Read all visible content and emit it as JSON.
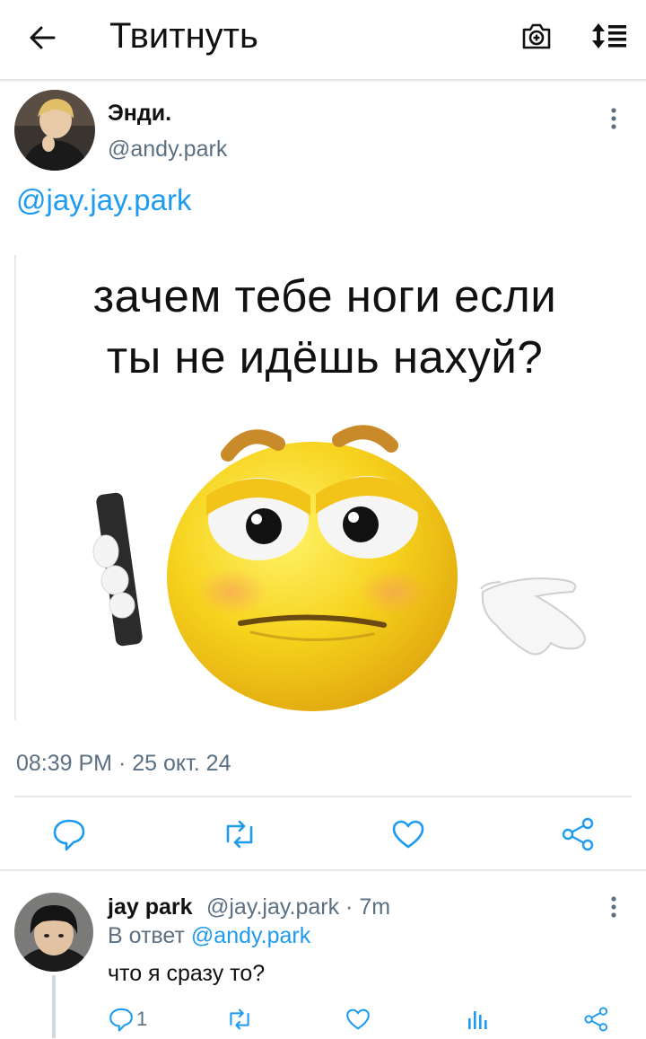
{
  "topbar": {
    "title": "Твитнуть",
    "back_icon": "arrow-left-icon",
    "camera_icon": "camera-icon",
    "sort_icon": "sort-icon"
  },
  "tweet": {
    "display_name": "Энди.",
    "handle": "@andy.park",
    "mention": "@jay.jay.park",
    "image_text_line1": "зачем тебе ноги если",
    "image_text_line2": "ты не идёшь нахуй?",
    "timestamp": "08:39 PM · 25 окт. 24",
    "actions": [
      "reply-icon",
      "retweet-icon",
      "like-icon",
      "share-icon"
    ]
  },
  "reply": {
    "display_name": "jay park",
    "meta": "@jay.jay.park · 7m",
    "in_reply_prefix": "В ответ",
    "in_reply_mention": "@andy.park",
    "text": "что я сразу то?",
    "reply_count": "1",
    "actions": [
      "reply-icon",
      "retweet-icon",
      "like-icon",
      "stats-icon",
      "share-icon"
    ]
  },
  "colors": {
    "link": "#1d9bf0",
    "muted": "#5b7083",
    "divider": "#e6e9eb"
  }
}
